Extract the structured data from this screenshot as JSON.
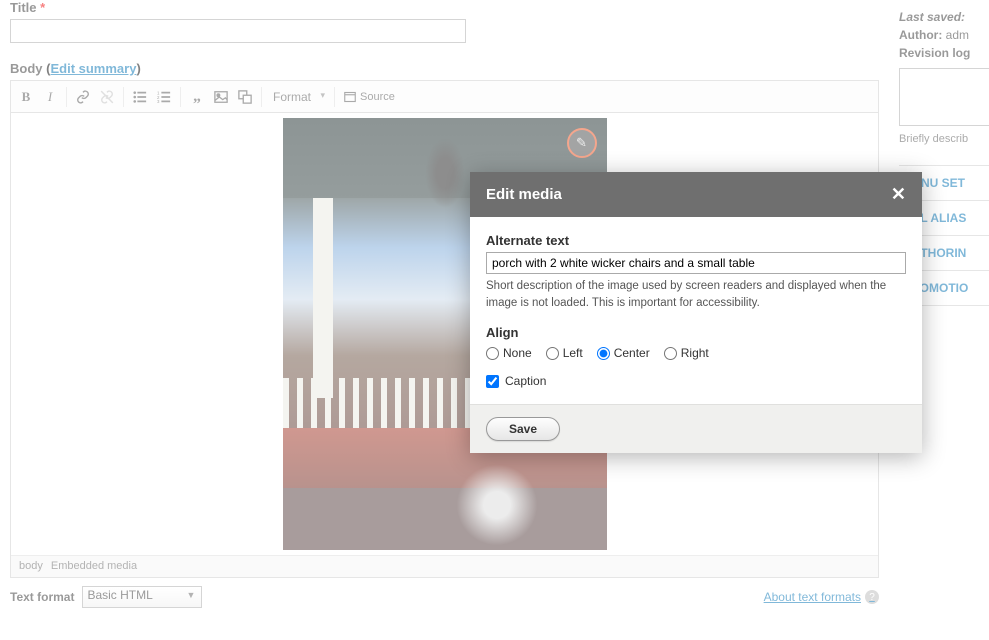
{
  "title": {
    "label": "Title",
    "required": "*",
    "value": ""
  },
  "body": {
    "label": "Body",
    "edit_summary": "Edit summary"
  },
  "toolbar": {
    "format_label": "Format",
    "source_label": "Source"
  },
  "editor_path": {
    "body": "body",
    "embedded": "Embedded media"
  },
  "text_format": {
    "label": "Text format",
    "value": "Basic HTML",
    "about": "About text formats"
  },
  "sidebar": {
    "last_saved_label": "Last saved:",
    "author_label": "Author:",
    "author_value": "adm",
    "revlog_label": "Revision log",
    "revlog_help": "Briefly describ",
    "tabs": [
      "MENU SET",
      "URL ALIAS",
      "AUTHORIN",
      "PROMOTIO"
    ]
  },
  "modal": {
    "title": "Edit media",
    "alt_label": "Alternate text",
    "alt_value": "porch with 2 white wicker chairs and a small table",
    "alt_desc": "Short description of the image used by screen readers and displayed when the image is not loaded. This is important for accessibility.",
    "align_label": "Align",
    "align_options": [
      "None",
      "Left",
      "Center",
      "Right"
    ],
    "align_selected": "Center",
    "caption_label": "Caption",
    "caption_checked": true,
    "save_label": "Save"
  },
  "icons": {
    "bold": "B",
    "italic": "I",
    "help": "?",
    "close": "✕",
    "pencil": "✎"
  }
}
